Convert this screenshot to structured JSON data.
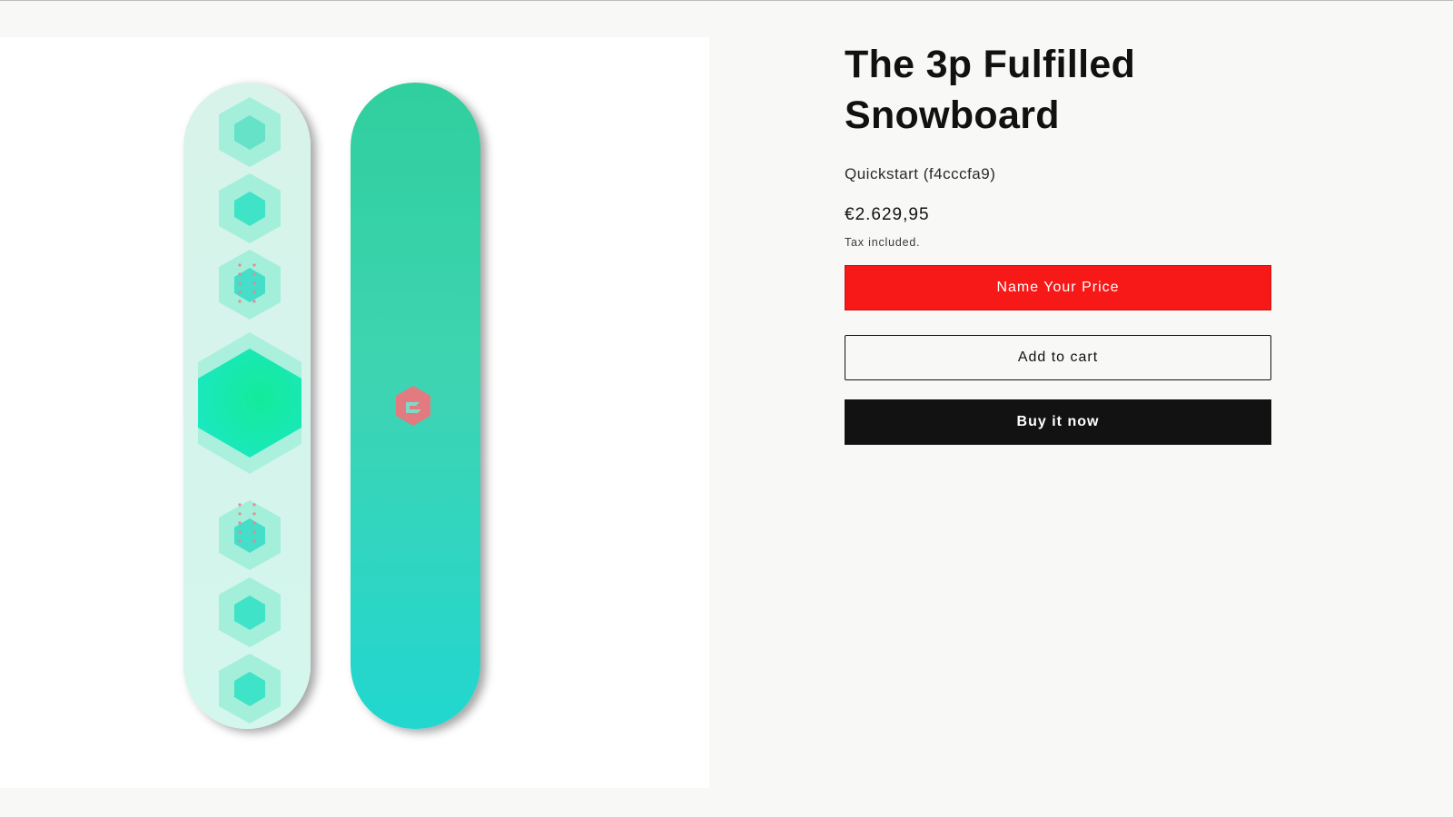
{
  "product": {
    "title_line1": "The 3p Fulfilled",
    "title_line2": "Snowboard",
    "vendor": "Quickstart (f4cccfa9)",
    "price": "€2.629,95",
    "tax_note": "Tax included.",
    "image_icon": "snowboard-image"
  },
  "actions": {
    "name_your_price": "Name Your Price",
    "add_to_cart": "Add to cart",
    "buy_now": "Buy it now"
  },
  "colors": {
    "accent_red": "#f71818",
    "button_dark": "#121212",
    "board_mint": "#d6f5ec",
    "board_teal": "#2bd3a8"
  }
}
